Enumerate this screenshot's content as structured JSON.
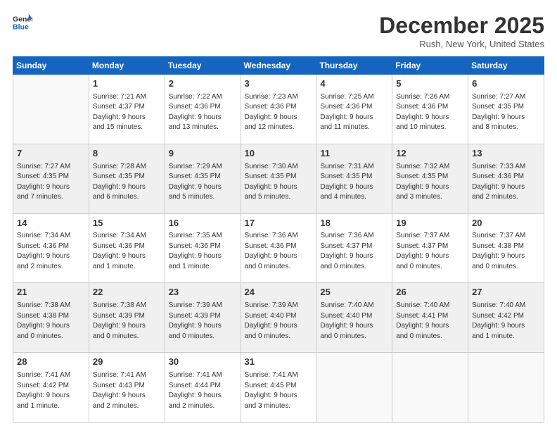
{
  "header": {
    "logo_general": "General",
    "logo_blue": "Blue",
    "month_title": "December 2025",
    "location": "Rush, New York, United States"
  },
  "days_of_week": [
    "Sunday",
    "Monday",
    "Tuesday",
    "Wednesday",
    "Thursday",
    "Friday",
    "Saturday"
  ],
  "weeks": [
    [
      {
        "day": "",
        "lines": []
      },
      {
        "day": "1",
        "lines": [
          "Sunrise: 7:21 AM",
          "Sunset: 4:37 PM",
          "Daylight: 9 hours",
          "and 15 minutes."
        ]
      },
      {
        "day": "2",
        "lines": [
          "Sunrise: 7:22 AM",
          "Sunset: 4:36 PM",
          "Daylight: 9 hours",
          "and 13 minutes."
        ]
      },
      {
        "day": "3",
        "lines": [
          "Sunrise: 7:23 AM",
          "Sunset: 4:36 PM",
          "Daylight: 9 hours",
          "and 12 minutes."
        ]
      },
      {
        "day": "4",
        "lines": [
          "Sunrise: 7:25 AM",
          "Sunset: 4:36 PM",
          "Daylight: 9 hours",
          "and 11 minutes."
        ]
      },
      {
        "day": "5",
        "lines": [
          "Sunrise: 7:26 AM",
          "Sunset: 4:36 PM",
          "Daylight: 9 hours",
          "and 10 minutes."
        ]
      },
      {
        "day": "6",
        "lines": [
          "Sunrise: 7:27 AM",
          "Sunset: 4:35 PM",
          "Daylight: 9 hours",
          "and 8 minutes."
        ]
      }
    ],
    [
      {
        "day": "7",
        "lines": [
          "Sunrise: 7:27 AM",
          "Sunset: 4:35 PM",
          "Daylight: 9 hours",
          "and 7 minutes."
        ]
      },
      {
        "day": "8",
        "lines": [
          "Sunrise: 7:28 AM",
          "Sunset: 4:35 PM",
          "Daylight: 9 hours",
          "and 6 minutes."
        ]
      },
      {
        "day": "9",
        "lines": [
          "Sunrise: 7:29 AM",
          "Sunset: 4:35 PM",
          "Daylight: 9 hours",
          "and 5 minutes."
        ]
      },
      {
        "day": "10",
        "lines": [
          "Sunrise: 7:30 AM",
          "Sunset: 4:35 PM",
          "Daylight: 9 hours",
          "and 5 minutes."
        ]
      },
      {
        "day": "11",
        "lines": [
          "Sunrise: 7:31 AM",
          "Sunset: 4:35 PM",
          "Daylight: 9 hours",
          "and 4 minutes."
        ]
      },
      {
        "day": "12",
        "lines": [
          "Sunrise: 7:32 AM",
          "Sunset: 4:35 PM",
          "Daylight: 9 hours",
          "and 3 minutes."
        ]
      },
      {
        "day": "13",
        "lines": [
          "Sunrise: 7:33 AM",
          "Sunset: 4:36 PM",
          "Daylight: 9 hours",
          "and 2 minutes."
        ]
      }
    ],
    [
      {
        "day": "14",
        "lines": [
          "Sunrise: 7:34 AM",
          "Sunset: 4:36 PM",
          "Daylight: 9 hours",
          "and 2 minutes."
        ]
      },
      {
        "day": "15",
        "lines": [
          "Sunrise: 7:34 AM",
          "Sunset: 4:36 PM",
          "Daylight: 9 hours",
          "and 1 minute."
        ]
      },
      {
        "day": "16",
        "lines": [
          "Sunrise: 7:35 AM",
          "Sunset: 4:36 PM",
          "Daylight: 9 hours",
          "and 1 minute."
        ]
      },
      {
        "day": "17",
        "lines": [
          "Sunrise: 7:36 AM",
          "Sunset: 4:36 PM",
          "Daylight: 9 hours",
          "and 0 minutes."
        ]
      },
      {
        "day": "18",
        "lines": [
          "Sunrise: 7:36 AM",
          "Sunset: 4:37 PM",
          "Daylight: 9 hours",
          "and 0 minutes."
        ]
      },
      {
        "day": "19",
        "lines": [
          "Sunrise: 7:37 AM",
          "Sunset: 4:37 PM",
          "Daylight: 9 hours",
          "and 0 minutes."
        ]
      },
      {
        "day": "20",
        "lines": [
          "Sunrise: 7:37 AM",
          "Sunset: 4:38 PM",
          "Daylight: 9 hours",
          "and 0 minutes."
        ]
      }
    ],
    [
      {
        "day": "21",
        "lines": [
          "Sunrise: 7:38 AM",
          "Sunset: 4:38 PM",
          "Daylight: 9 hours",
          "and 0 minutes."
        ]
      },
      {
        "day": "22",
        "lines": [
          "Sunrise: 7:38 AM",
          "Sunset: 4:39 PM",
          "Daylight: 9 hours",
          "and 0 minutes."
        ]
      },
      {
        "day": "23",
        "lines": [
          "Sunrise: 7:39 AM",
          "Sunset: 4:39 PM",
          "Daylight: 9 hours",
          "and 0 minutes."
        ]
      },
      {
        "day": "24",
        "lines": [
          "Sunrise: 7:39 AM",
          "Sunset: 4:40 PM",
          "Daylight: 9 hours",
          "and 0 minutes."
        ]
      },
      {
        "day": "25",
        "lines": [
          "Sunrise: 7:40 AM",
          "Sunset: 4:40 PM",
          "Daylight: 9 hours",
          "and 0 minutes."
        ]
      },
      {
        "day": "26",
        "lines": [
          "Sunrise: 7:40 AM",
          "Sunset: 4:41 PM",
          "Daylight: 9 hours",
          "and 0 minutes."
        ]
      },
      {
        "day": "27",
        "lines": [
          "Sunrise: 7:40 AM",
          "Sunset: 4:42 PM",
          "Daylight: 9 hours",
          "and 1 minute."
        ]
      }
    ],
    [
      {
        "day": "28",
        "lines": [
          "Sunrise: 7:41 AM",
          "Sunset: 4:42 PM",
          "Daylight: 9 hours",
          "and 1 minute."
        ]
      },
      {
        "day": "29",
        "lines": [
          "Sunrise: 7:41 AM",
          "Sunset: 4:43 PM",
          "Daylight: 9 hours",
          "and 2 minutes."
        ]
      },
      {
        "day": "30",
        "lines": [
          "Sunrise: 7:41 AM",
          "Sunset: 4:44 PM",
          "Daylight: 9 hours",
          "and 2 minutes."
        ]
      },
      {
        "day": "31",
        "lines": [
          "Sunrise: 7:41 AM",
          "Sunset: 4:45 PM",
          "Daylight: 9 hours",
          "and 3 minutes."
        ]
      },
      {
        "day": "",
        "lines": []
      },
      {
        "day": "",
        "lines": []
      },
      {
        "day": "",
        "lines": []
      }
    ]
  ]
}
